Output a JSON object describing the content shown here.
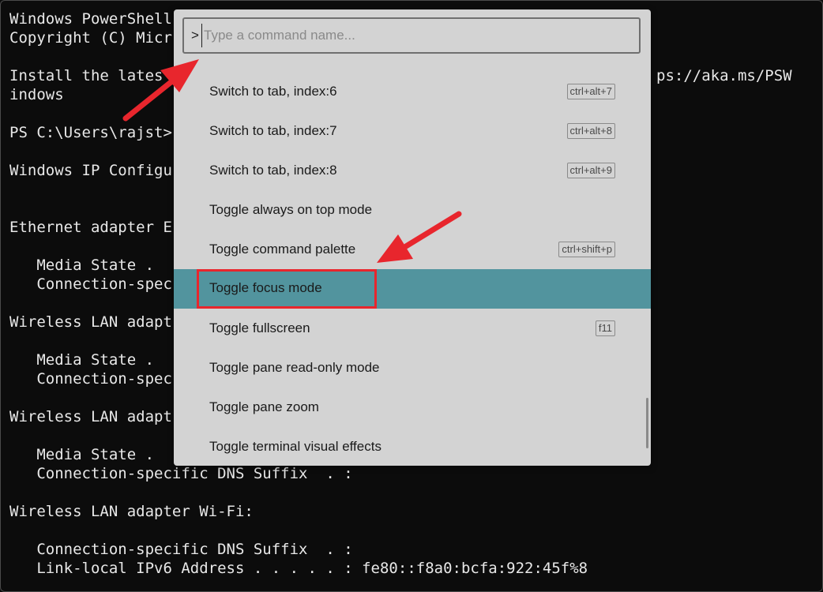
{
  "terminal": {
    "lines": [
      "Windows PowerShell",
      "Copyright (C) Micr",
      "Install the lates",
      "indows",
      "PS C:\\Users\\rajst>",
      "Windows IP Configu",
      "Ethernet adapter E",
      "   Media State .",
      "   Connection-spec",
      "Wireless LAN adapt",
      "   Media State .",
      "   Connection-spec",
      "Wireless LAN adapt",
      "   Media State .",
      "   Connection-specific DNS Suffix  . :",
      "Wireless LAN adapter Wi-Fi:",
      "   Connection-specific DNS Suffix  . :",
      "   Link-local IPv6 Address . . . . . : fe80::f8a0:bcfa:922:45f%8"
    ],
    "right_fragment": "ps://aka.ms/PSW"
  },
  "palette": {
    "prefix": ">",
    "placeholder": "Type a command name...",
    "items": [
      {
        "label": "Switch to tab, index:6",
        "key": "ctrl+alt+7"
      },
      {
        "label": "Switch to tab, index:7",
        "key": "ctrl+alt+8"
      },
      {
        "label": "Switch to tab, index:8",
        "key": "ctrl+alt+9"
      },
      {
        "label": "Toggle always on top mode",
        "key": ""
      },
      {
        "label": "Toggle command palette",
        "key": "ctrl+shift+p"
      },
      {
        "label": "Toggle focus mode",
        "key": ""
      },
      {
        "label": "Toggle fullscreen",
        "key": "f11"
      },
      {
        "label": "Toggle pane read-only mode",
        "key": ""
      },
      {
        "label": "Toggle pane zoom",
        "key": ""
      },
      {
        "label": "Toggle terminal visual effects",
        "key": ""
      }
    ],
    "selected_label": "Toggle focus mode"
  },
  "colors": {
    "selected_bg": "#52949e",
    "palette_bg": "#d3d3d3",
    "annotation_red": "#e8262d"
  }
}
